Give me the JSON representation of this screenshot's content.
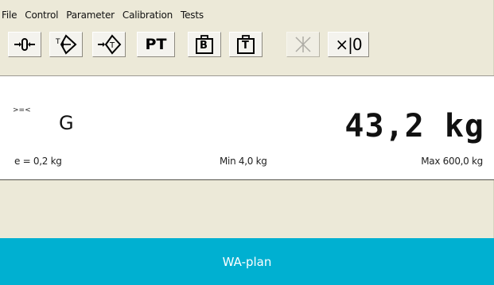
{
  "menu": {
    "items": [
      "File",
      "Control",
      "Parameter",
      "Calibration",
      "Tests"
    ]
  },
  "toolbar": {
    "buttons": [
      {
        "icon": "zero-icon",
        "enabled": true
      },
      {
        "icon": "tare-icon",
        "enabled": true
      },
      {
        "icon": "clear-tare-icon",
        "enabled": true
      },
      {
        "label": "PT",
        "icon": "preset-tare-text",
        "enabled": true
      },
      {
        "label": "B",
        "icon": "gross-weight-icon",
        "enabled": true
      },
      {
        "label": "T",
        "icon": "tare-weight-icon",
        "enabled": true
      },
      {
        "icon": "ten-times-icon",
        "enabled": false
      },
      {
        "label": "×|0",
        "icon": "print-icon",
        "enabled": true
      }
    ],
    "pt_label": "PT",
    "b_label": "B",
    "t_label": "T",
    "last_label": "×|0"
  },
  "display": {
    "indicator": ">=<",
    "mode": "G",
    "weight": "43,2 kg",
    "e": "e = 0,2 kg",
    "min": "Min 4,0 kg",
    "max": "Max 600,0 kg"
  },
  "caption": {
    "text": "WA-plan",
    "color": "#00b0d1"
  }
}
